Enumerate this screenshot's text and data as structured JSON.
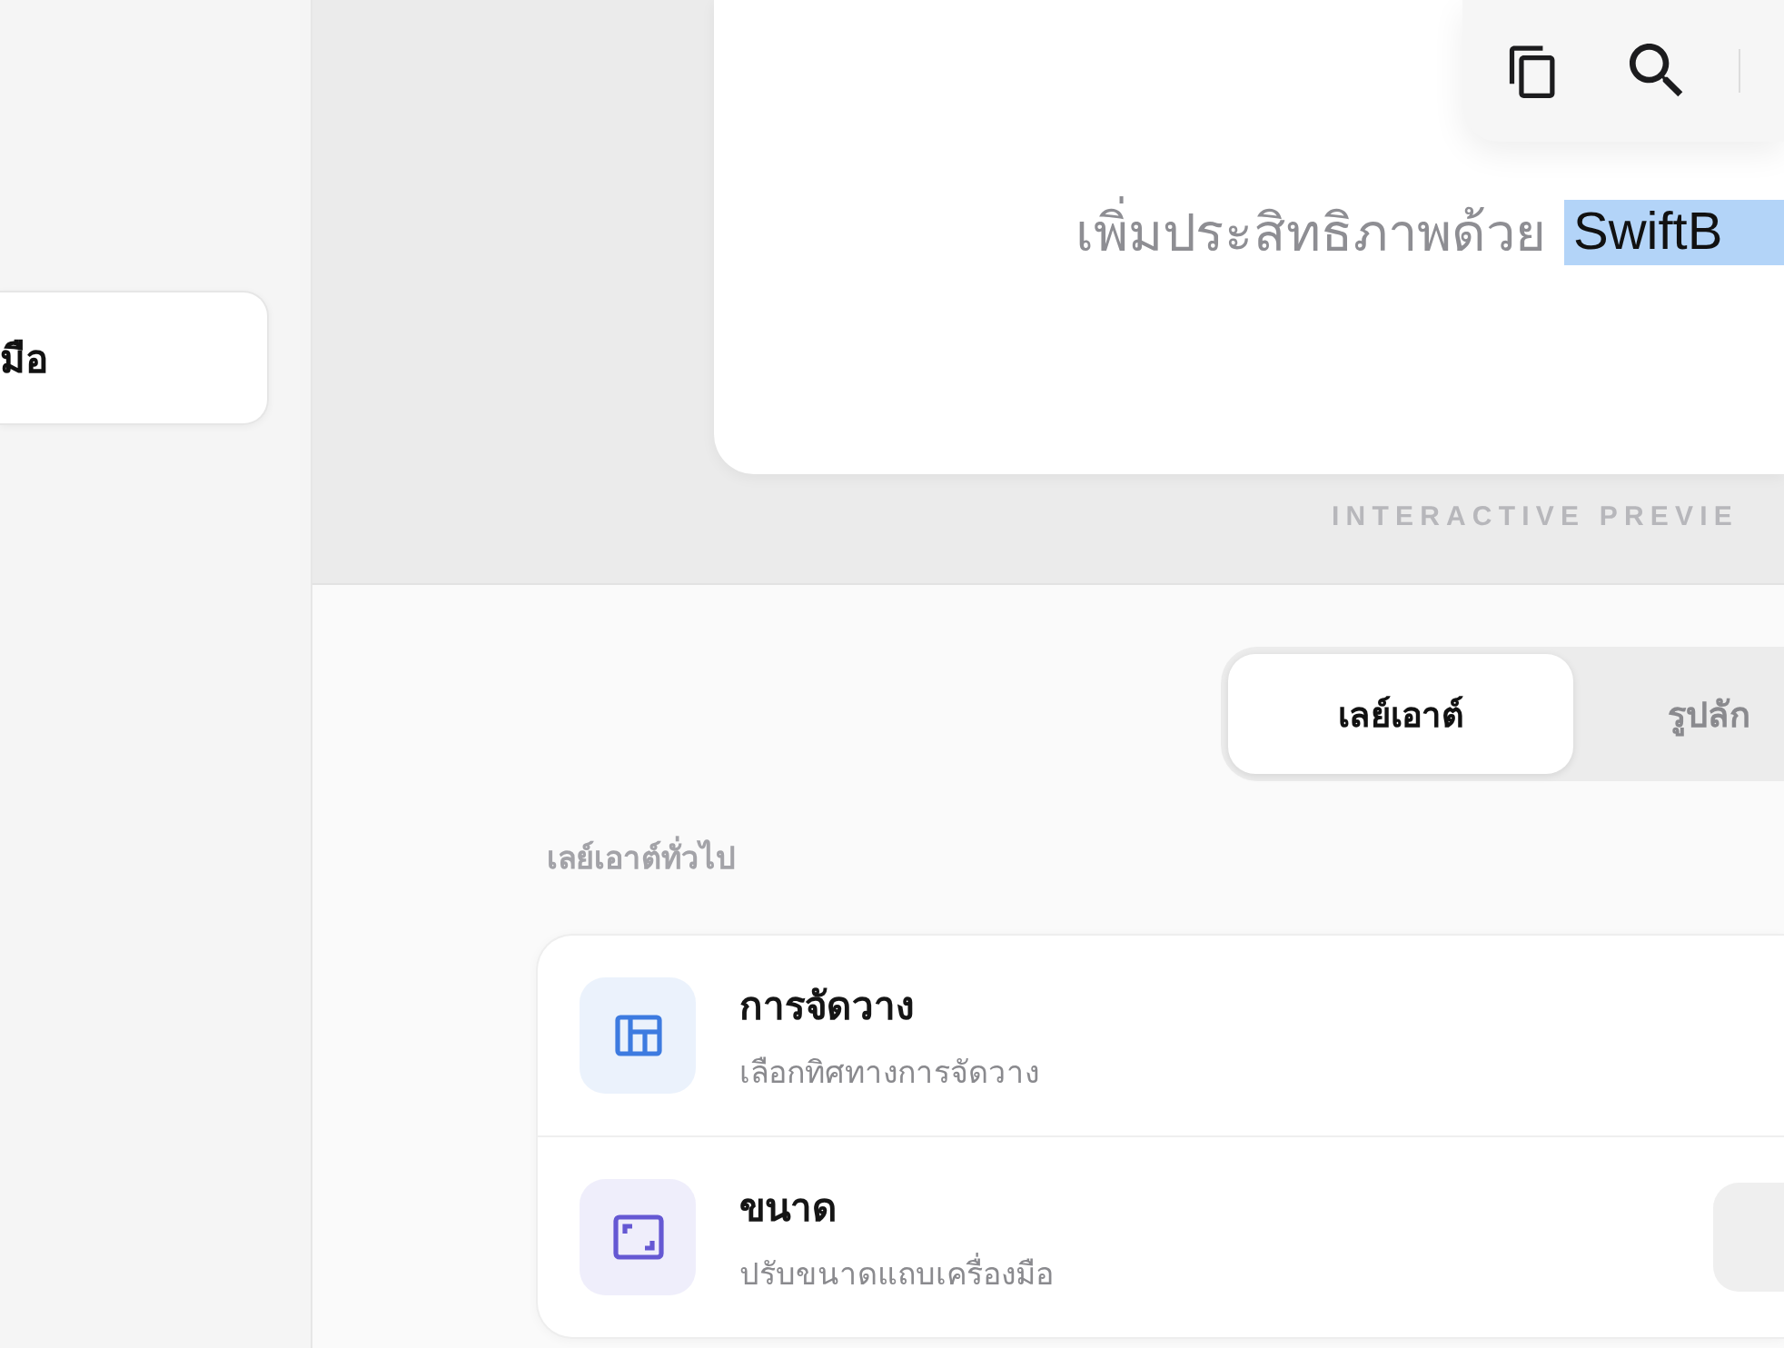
{
  "sidebar": {
    "items": [
      {
        "label": "มือ",
        "selected": true
      }
    ]
  },
  "preview": {
    "toolbar": [
      {
        "kind": "copy"
      },
      {
        "kind": "search"
      }
    ],
    "headline": "เพิ่มประสิทธิภาพด้วย",
    "selected_text": "SwiftB",
    "caption": "INTERACTIVE PREVIE"
  },
  "tabs": [
    {
      "label": "เลย์เอาต์",
      "selected": true
    },
    {
      "label": "รูปลัก",
      "selected": false
    }
  ],
  "section": {
    "title": "เลย์เอาต์ทั่วไป",
    "rows": [
      {
        "kind": "plain",
        "color": "#3d7be0",
        "title": "การจัดวาง",
        "subtitle": "เลือกทิศทางการจัดวาง"
      },
      {
        "kind": "control",
        "color": "#6558d3",
        "title": "ขนาด",
        "subtitle": "ปรับขนาดแถบเครื่องมือ"
      }
    ]
  }
}
